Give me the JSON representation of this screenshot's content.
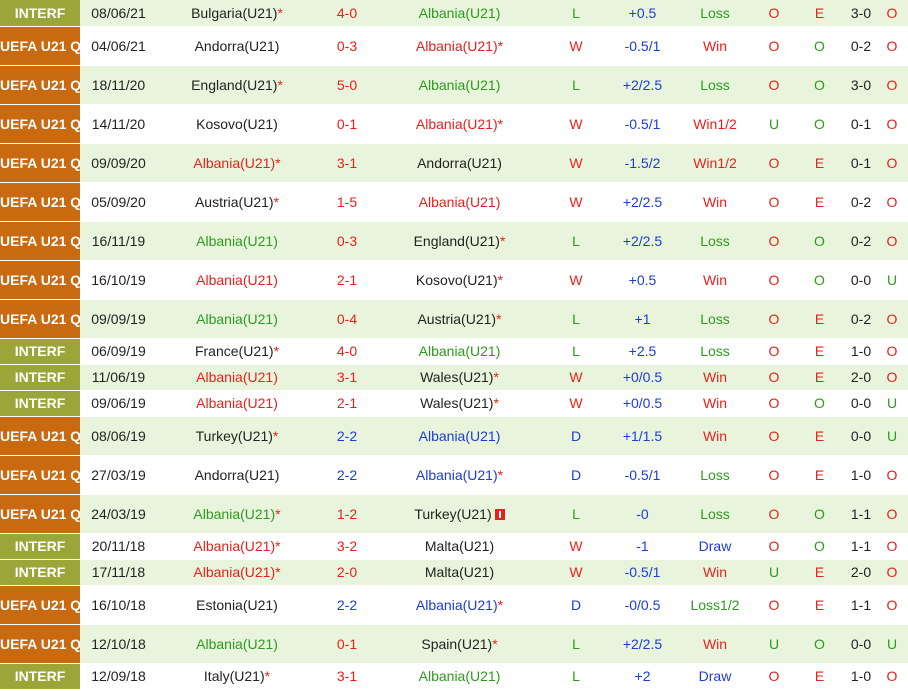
{
  "colors": {
    "win": "#e8211c",
    "loss": "#2e9a1e",
    "draw": "#1d3bd6",
    "interf": "#9aa637",
    "uefa": "#c96a10"
  },
  "rows": [
    {
      "comp": "INTERF",
      "ctype": "interf",
      "date": "08/06/21",
      "home": "Bulgaria(U21)",
      "home_color": "black",
      "home_star": "*",
      "score": "4-0",
      "score_color": "red",
      "away": "Albania(U21)",
      "away_color": "green",
      "away_star": "",
      "res": "L",
      "res_color": "green",
      "hcp": "+0.5",
      "hcp_res": "Loss",
      "hcp_color": "green",
      "oe": "O",
      "oe_color": "red",
      "ou": "E",
      "ou_color": "red",
      "ht": "3-0",
      "last": "O",
      "last_color": "red",
      "h": 26
    },
    {
      "comp": "UEFA U21 Q",
      "ctype": "uefa",
      "date": "04/06/21",
      "home": "Andorra(U21)",
      "home_color": "black",
      "home_star": "",
      "score": "0-3",
      "score_color": "red",
      "away": "Albania(U21)",
      "away_color": "red",
      "away_star": "*",
      "res": "W",
      "res_color": "red",
      "hcp": "-0.5/1",
      "hcp_res": "Win",
      "hcp_color": "red",
      "oe": "O",
      "oe_color": "red",
      "ou": "O",
      "ou_color": "green",
      "ht": "0-2",
      "last": "O",
      "last_color": "red",
      "h": 39
    },
    {
      "comp": "UEFA U21 Q",
      "ctype": "uefa",
      "date": "18/11/20",
      "home": "England(U21)",
      "home_color": "black",
      "home_star": "*",
      "score": "5-0",
      "score_color": "red",
      "away": "Albania(U21)",
      "away_color": "green",
      "away_star": "",
      "res": "L",
      "res_color": "green",
      "hcp": "+2/2.5",
      "hcp_res": "Loss",
      "hcp_color": "green",
      "oe": "O",
      "oe_color": "red",
      "ou": "O",
      "ou_color": "green",
      "ht": "3-0",
      "last": "O",
      "last_color": "red",
      "h": 39
    },
    {
      "comp": "UEFA U21 Q",
      "ctype": "uefa",
      "date": "14/11/20",
      "home": "Kosovo(U21)",
      "home_color": "black",
      "home_star": "",
      "score": "0-1",
      "score_color": "red",
      "away": "Albania(U21)",
      "away_color": "red",
      "away_star": "*",
      "res": "W",
      "res_color": "red",
      "hcp": "-0.5/1",
      "hcp_res": "Win1/2",
      "hcp_color": "red",
      "oe": "U",
      "oe_color": "green",
      "ou": "O",
      "ou_color": "green",
      "ht": "0-1",
      "last": "O",
      "last_color": "red",
      "h": 39
    },
    {
      "comp": "UEFA U21 Q",
      "ctype": "uefa",
      "date": "09/09/20",
      "home": "Albania(U21)",
      "home_color": "red",
      "home_star": "*",
      "score": "3-1",
      "score_color": "red",
      "away": "Andorra(U21)",
      "away_color": "black",
      "away_star": "",
      "res": "W",
      "res_color": "red",
      "hcp": "-1.5/2",
      "hcp_res": "Win1/2",
      "hcp_color": "red",
      "oe": "O",
      "oe_color": "red",
      "ou": "E",
      "ou_color": "red",
      "ht": "0-1",
      "last": "O",
      "last_color": "red",
      "h": 39
    },
    {
      "comp": "UEFA U21 Q",
      "ctype": "uefa",
      "date": "05/09/20",
      "home": "Austria(U21)",
      "home_color": "black",
      "home_star": "*",
      "score": "1-5",
      "score_color": "red",
      "away": "Albania(U21)",
      "away_color": "red",
      "away_star": "",
      "res": "W",
      "res_color": "red",
      "hcp": "+2/2.5",
      "hcp_res": "Win",
      "hcp_color": "red",
      "oe": "O",
      "oe_color": "red",
      "ou": "E",
      "ou_color": "red",
      "ht": "0-2",
      "last": "O",
      "last_color": "red",
      "h": 39
    },
    {
      "comp": "UEFA U21 Q",
      "ctype": "uefa",
      "date": "16/11/19",
      "home": "Albania(U21)",
      "home_color": "green",
      "home_star": "",
      "score": "0-3",
      "score_color": "red",
      "away": "England(U21)",
      "away_color": "black",
      "away_star": "*",
      "res": "L",
      "res_color": "green",
      "hcp": "+2/2.5",
      "hcp_res": "Loss",
      "hcp_color": "green",
      "oe": "O",
      "oe_color": "red",
      "ou": "O",
      "ou_color": "green",
      "ht": "0-2",
      "last": "O",
      "last_color": "red",
      "h": 39
    },
    {
      "comp": "UEFA U21 Q",
      "ctype": "uefa",
      "date": "16/10/19",
      "home": "Albania(U21)",
      "home_color": "red",
      "home_star": "",
      "score": "2-1",
      "score_color": "red",
      "away": "Kosovo(U21)",
      "away_color": "black",
      "away_star": "*",
      "res": "W",
      "res_color": "red",
      "hcp": "+0.5",
      "hcp_res": "Win",
      "hcp_color": "red",
      "oe": "O",
      "oe_color": "red",
      "ou": "O",
      "ou_color": "green",
      "ht": "0-0",
      "last": "U",
      "last_color": "green",
      "h": 39
    },
    {
      "comp": "UEFA U21 Q",
      "ctype": "uefa",
      "date": "09/09/19",
      "home": "Albania(U21)",
      "home_color": "green",
      "home_star": "",
      "score": "0-4",
      "score_color": "red",
      "away": "Austria(U21)",
      "away_color": "black",
      "away_star": "*",
      "res": "L",
      "res_color": "green",
      "hcp": "+1",
      "hcp_res": "Loss",
      "hcp_color": "green",
      "oe": "O",
      "oe_color": "red",
      "ou": "E",
      "ou_color": "red",
      "ht": "0-2",
      "last": "O",
      "last_color": "red",
      "h": 39
    },
    {
      "comp": "INTERF",
      "ctype": "interf",
      "date": "06/09/19",
      "home": "France(U21)",
      "home_color": "black",
      "home_star": "*",
      "score": "4-0",
      "score_color": "red",
      "away": "Albania(U21)",
      "away_color": "green",
      "away_star": "",
      "res": "L",
      "res_color": "green",
      "hcp": "+2.5",
      "hcp_res": "Loss",
      "hcp_color": "green",
      "oe": "O",
      "oe_color": "red",
      "ou": "E",
      "ou_color": "red",
      "ht": "1-0",
      "last": "O",
      "last_color": "red",
      "h": 26
    },
    {
      "comp": "INTERF",
      "ctype": "interf",
      "date": "11/06/19",
      "home": "Albania(U21)",
      "home_color": "red",
      "home_star": "",
      "score": "3-1",
      "score_color": "red",
      "away": "Wales(U21)",
      "away_color": "black",
      "away_star": "*",
      "res": "W",
      "res_color": "red",
      "hcp": "+0/0.5",
      "hcp_res": "Win",
      "hcp_color": "red",
      "oe": "O",
      "oe_color": "red",
      "ou": "E",
      "ou_color": "red",
      "ht": "2-0",
      "last": "O",
      "last_color": "red",
      "h": 26
    },
    {
      "comp": "INTERF",
      "ctype": "interf",
      "date": "09/06/19",
      "home": "Albania(U21)",
      "home_color": "red",
      "home_star": "",
      "score": "2-1",
      "score_color": "red",
      "away": "Wales(U21)",
      "away_color": "black",
      "away_star": "*",
      "res": "W",
      "res_color": "red",
      "hcp": "+0/0.5",
      "hcp_res": "Win",
      "hcp_color": "red",
      "oe": "O",
      "oe_color": "red",
      "ou": "O",
      "ou_color": "green",
      "ht": "0-0",
      "last": "U",
      "last_color": "green",
      "h": 26
    },
    {
      "comp": "UEFA U21 Q",
      "ctype": "uefa",
      "date": "08/06/19",
      "home": "Turkey(U21)",
      "home_color": "black",
      "home_star": "*",
      "score": "2-2",
      "score_color": "blue",
      "away": "Albania(U21)",
      "away_color": "blue",
      "away_star": "",
      "res": "D",
      "res_color": "blue",
      "hcp": "+1/1.5",
      "hcp_res": "Win",
      "hcp_color": "red",
      "oe": "O",
      "oe_color": "red",
      "ou": "E",
      "ou_color": "red",
      "ht": "0-0",
      "last": "U",
      "last_color": "green",
      "h": 39
    },
    {
      "comp": "UEFA U21 Q",
      "ctype": "uefa",
      "date": "27/03/19",
      "home": "Andorra(U21)",
      "home_color": "black",
      "home_star": "",
      "score": "2-2",
      "score_color": "blue",
      "away": "Albania(U21)",
      "away_color": "blue",
      "away_star": "*",
      "res": "D",
      "res_color": "blue",
      "hcp": "-0.5/1",
      "hcp_res": "Loss",
      "hcp_color": "green",
      "oe": "O",
      "oe_color": "red",
      "ou": "E",
      "ou_color": "red",
      "ht": "1-0",
      "last": "O",
      "last_color": "red",
      "h": 39
    },
    {
      "comp": "UEFA U21 Q",
      "ctype": "uefa",
      "date": "24/03/19",
      "home": "Albania(U21)",
      "home_color": "green",
      "home_star": "*",
      "score": "1-2",
      "score_color": "red",
      "away": "Turkey(U21)",
      "away_color": "black",
      "away_star": "",
      "away_flag": true,
      "res": "L",
      "res_color": "green",
      "hcp": "-0",
      "hcp_res": "Loss",
      "hcp_color": "green",
      "oe": "O",
      "oe_color": "red",
      "ou": "O",
      "ou_color": "green",
      "ht": "1-1",
      "last": "O",
      "last_color": "red",
      "h": 39
    },
    {
      "comp": "INTERF",
      "ctype": "interf",
      "date": "20/11/18",
      "home": "Albania(U21)",
      "home_color": "red",
      "home_star": "*",
      "score": "3-2",
      "score_color": "red",
      "away": "Malta(U21)",
      "away_color": "black",
      "away_star": "",
      "res": "W",
      "res_color": "red",
      "hcp": "-1",
      "hcp_res": "Draw",
      "hcp_color": "blue",
      "oe": "O",
      "oe_color": "red",
      "ou": "O",
      "ou_color": "green",
      "ht": "1-1",
      "last": "O",
      "last_color": "red",
      "h": 26
    },
    {
      "comp": "INTERF",
      "ctype": "interf",
      "date": "17/11/18",
      "home": "Albania(U21)",
      "home_color": "red",
      "home_star": "*",
      "score": "2-0",
      "score_color": "red",
      "away": "Malta(U21)",
      "away_color": "black",
      "away_star": "",
      "res": "W",
      "res_color": "red",
      "hcp": "-0.5/1",
      "hcp_res": "Win",
      "hcp_color": "red",
      "oe": "U",
      "oe_color": "green",
      "ou": "E",
      "ou_color": "red",
      "ht": "2-0",
      "last": "O",
      "last_color": "red",
      "h": 26
    },
    {
      "comp": "UEFA U21 Q",
      "ctype": "uefa",
      "date": "16/10/18",
      "home": "Estonia(U21)",
      "home_color": "black",
      "home_star": "",
      "score": "2-2",
      "score_color": "blue",
      "away": "Albania(U21)",
      "away_color": "blue",
      "away_star": "*",
      "res": "D",
      "res_color": "blue",
      "hcp": "-0/0.5",
      "hcp_res": "Loss1/2",
      "hcp_color": "green",
      "oe": "O",
      "oe_color": "red",
      "ou": "E",
      "ou_color": "red",
      "ht": "1-1",
      "last": "O",
      "last_color": "red",
      "h": 39
    },
    {
      "comp": "UEFA U21 Q",
      "ctype": "uefa",
      "date": "12/10/18",
      "home": "Albania(U21)",
      "home_color": "green",
      "home_star": "",
      "score": "0-1",
      "score_color": "red",
      "away": "Spain(U21)",
      "away_color": "black",
      "away_star": "*",
      "res": "L",
      "res_color": "green",
      "hcp": "+2/2.5",
      "hcp_res": "Win",
      "hcp_color": "red",
      "oe": "U",
      "oe_color": "green",
      "ou": "O",
      "ou_color": "green",
      "ht": "0-0",
      "last": "U",
      "last_color": "green",
      "h": 39
    },
    {
      "comp": "INTERF",
      "ctype": "interf",
      "date": "12/09/18",
      "home": "Italy(U21)",
      "home_color": "black",
      "home_star": "*",
      "score": "3-1",
      "score_color": "red",
      "away": "Albania(U21)",
      "away_color": "green",
      "away_star": "",
      "res": "L",
      "res_color": "green",
      "hcp": "+2",
      "hcp_res": "Draw",
      "hcp_color": "blue",
      "oe": "O",
      "oe_color": "red",
      "ou": "E",
      "ou_color": "red",
      "ht": "1-0",
      "last": "O",
      "last_color": "red",
      "h": 26
    }
  ]
}
